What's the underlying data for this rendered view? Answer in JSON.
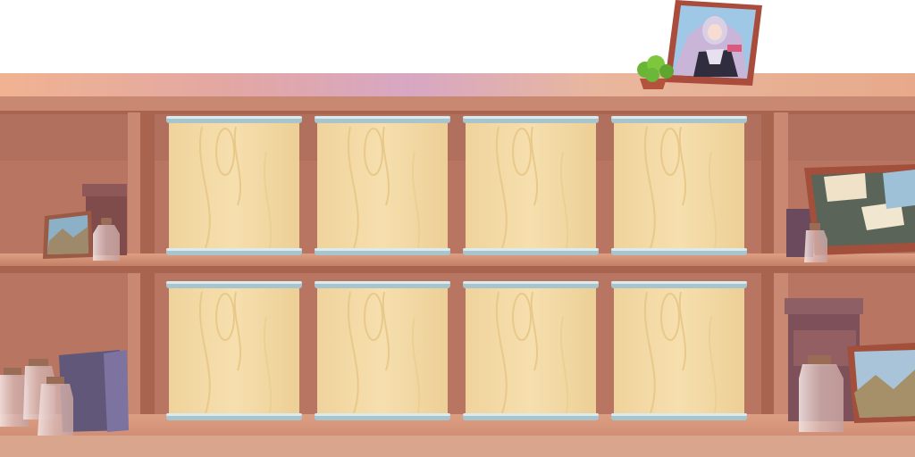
{
  "scene": {
    "type": "storage shelf",
    "slot_count": 8,
    "rows": [
      {
        "slots": [
          {
            "state": "empty"
          },
          {
            "state": "empty"
          },
          {
            "state": "empty"
          },
          {
            "state": "empty"
          }
        ]
      },
      {
        "slots": [
          {
            "state": "empty"
          },
          {
            "state": "empty"
          },
          {
            "state": "empty"
          },
          {
            "state": "empty"
          }
        ]
      }
    ]
  },
  "decor": {
    "top": [
      "framed-character-portrait",
      "potted-plant"
    ],
    "left_upper": [
      "landscape-frame",
      "box-stack",
      "glass-bottle"
    ],
    "left_lower": [
      "glass-bottles",
      "purple-boxes"
    ],
    "right_upper": [
      "corkboard",
      "glass-bottle",
      "box"
    ],
    "right_lower": [
      "box-stack",
      "glass-bottle",
      "landscape-frame"
    ]
  },
  "colors": {
    "shelf_wood": "#c98871",
    "shelf_dark": "#a8644f",
    "back_panel": "#b87662",
    "panel_wood": "#f6dfae",
    "panel_rail": "#a8c4cc"
  }
}
